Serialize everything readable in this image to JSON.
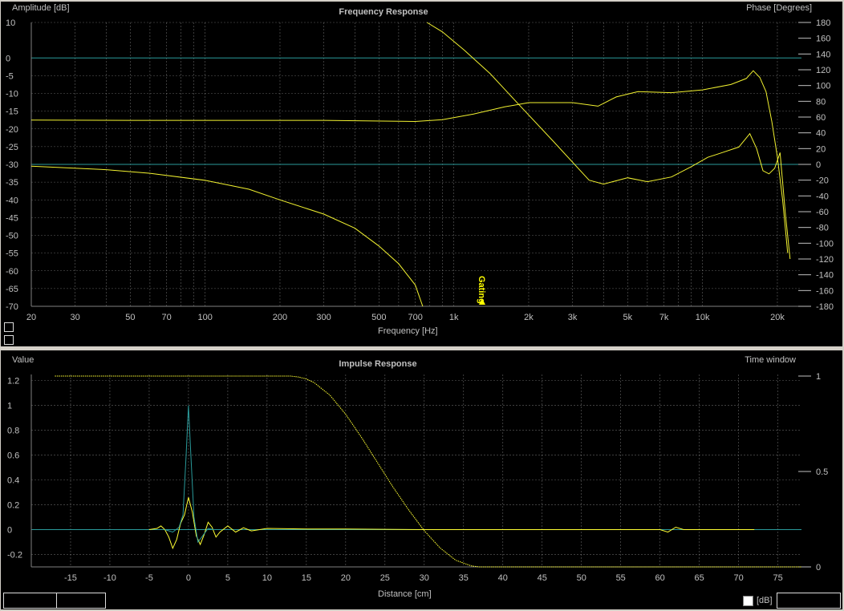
{
  "colors": {
    "background": "#000000",
    "grid": "#b4b4b4",
    "text": "#c0c0c0",
    "yellow": "#ffff33",
    "teal": "#2a9a9a",
    "marker": "#ffff00"
  },
  "frequency_panel": {
    "title": "Frequency Response",
    "left_axis_label": "Amplitude [dB]",
    "right_axis_label": "Phase [Degrees]",
    "x_axis_label": "Frequency [Hz]",
    "marker_label": "Gating"
  },
  "impulse_panel": {
    "title": "Impulse Response",
    "left_axis_label": "Value",
    "right_axis_label": "Time window",
    "x_axis_label": "Distance [cm]",
    "db_label": "[dB]"
  },
  "chart_data": [
    {
      "type": "line",
      "title": "Frequency Response",
      "xlabel": "Frequency [Hz]",
      "ylabel": "Amplitude [dB]",
      "y2label": "Phase [Degrees]",
      "xscale": "log",
      "xlim": [
        20,
        25000
      ],
      "ylim": [
        -70,
        10
      ],
      "y2lim": [
        -180,
        180
      ],
      "grid": true,
      "x_ticks": [
        20,
        30,
        50,
        70,
        100,
        200,
        300,
        500,
        700,
        1000,
        2000,
        3000,
        5000,
        7000,
        10000,
        20000
      ],
      "x_tick_labels": [
        "20",
        "30",
        "50",
        "70",
        "100",
        "200",
        "300",
        "500",
        "700",
        "1k",
        "2k",
        "3k",
        "5k",
        "7k",
        "10k",
        "20k"
      ],
      "y_ticks": [
        10,
        0,
        -5,
        -10,
        -15,
        -20,
        -25,
        -30,
        -35,
        -40,
        -45,
        -50,
        -55,
        -60,
        -65,
        -70
      ],
      "y2_ticks": [
        180,
        160,
        140,
        120,
        100,
        80,
        60,
        40,
        20,
        0,
        -20,
        -40,
        -60,
        -80,
        -100,
        -120,
        -140,
        -160,
        -180
      ],
      "reference_lines_db": [
        0,
        -30
      ],
      "gating_marker_hz": 1300,
      "series": [
        {
          "axis": "left",
          "x": [
            20,
            50,
            100,
            300,
            700,
            900,
            1200,
            1600,
            2000,
            3000,
            3800,
            4500,
            5500,
            7500,
            10000,
            13000,
            15000,
            16000,
            17000,
            18000,
            19000,
            20000,
            21000,
            22000
          ],
          "y": [
            -17.5,
            -17.6,
            -17.6,
            -17.6,
            -17.9,
            -17.4,
            -15.8,
            -13.8,
            -12.6,
            -12.6,
            -13.6,
            -11.0,
            -9.5,
            -9.8,
            -9.0,
            -7.5,
            -5.8,
            -3.6,
            -5.5,
            -9.5,
            -18,
            -28,
            -40,
            -55
          ]
        },
        {
          "axis": "left",
          "x": [
            20,
            40,
            60,
            100,
            150,
            200,
            300,
            400,
            500,
            600,
            700,
            750
          ],
          "y": [
            -30.5,
            -31.5,
            -32.5,
            -34.5,
            -37,
            -40,
            -44,
            -48,
            -53,
            -58,
            -64,
            -70
          ]
        },
        {
          "axis": "right",
          "x": [
            780,
            900,
            1100,
            1400,
            1800,
            2500,
            3500,
            4000,
            5000,
            6000,
            7500,
            9000,
            10500,
            12000,
            14000,
            15500,
            16500,
            17500,
            18500,
            19500,
            20500,
            21500,
            22500
          ],
          "y": [
            180,
            168,
            145,
            115,
            78,
            30,
            -20,
            -25,
            -17,
            -22,
            -16,
            -3,
            9,
            15,
            22,
            39,
            20,
            -8,
            -12,
            -5,
            15,
            -60,
            -120
          ]
        }
      ]
    },
    {
      "type": "line",
      "title": "Impulse Response",
      "xlabel": "Distance [cm]",
      "ylabel": "Value",
      "y2label": "Time window",
      "xlim": [
        -20,
        78
      ],
      "ylim": [
        -0.3,
        1.25
      ],
      "y2lim": [
        0,
        1
      ],
      "grid": true,
      "x_ticks": [
        -15,
        -10,
        -5,
        0,
        5,
        10,
        15,
        20,
        25,
        30,
        35,
        40,
        45,
        50,
        55,
        60,
        65,
        70,
        75
      ],
      "y_ticks": [
        1.2,
        1,
        0.8,
        0.6,
        0.4,
        0.2,
        0,
        -0.2
      ],
      "y2_ticks": [
        1,
        0.5,
        0
      ],
      "series": [
        {
          "axis": "right",
          "x": [
            -17,
            13,
            14,
            15,
            16,
            18,
            20,
            22,
            24,
            26,
            28,
            30,
            32,
            34,
            36,
            37,
            78
          ],
          "y": [
            1,
            1,
            0.995,
            0.985,
            0.965,
            0.9,
            0.8,
            0.68,
            0.55,
            0.42,
            0.3,
            0.19,
            0.1,
            0.035,
            0.005,
            0,
            0
          ]
        },
        {
          "axis": "left",
          "x": [
            -5,
            -4,
            -3.5,
            -3,
            -2.5,
            -2,
            -1.5,
            -1,
            -0.5,
            0,
            0.5,
            1,
            1.5,
            2,
            2.5,
            3,
            3.5,
            4,
            5,
            6,
            7,
            8,
            10,
            15,
            20,
            30,
            60,
            61,
            62,
            63,
            72
          ],
          "y": [
            0,
            0.01,
            0.03,
            0.0,
            -0.06,
            -0.15,
            -0.08,
            0.05,
            0.12,
            0.26,
            0.14,
            -0.05,
            -0.12,
            -0.04,
            0.06,
            0.02,
            -0.06,
            -0.02,
            0.03,
            -0.02,
            0.015,
            -0.01,
            0.01,
            0.005,
            0.005,
            0,
            0,
            -0.02,
            0.02,
            0,
            0
          ]
        },
        {
          "axis": "left",
          "x": [
            -3,
            -2,
            -1.2,
            -0.7,
            -0.3,
            0,
            0.3,
            0.7,
            1.2,
            1.8,
            2.5,
            3.2
          ],
          "y": [
            0,
            -0.02,
            0.02,
            0.12,
            0.6,
            1.0,
            0.6,
            0.1,
            -0.1,
            -0.05,
            0.01,
            0
          ]
        }
      ]
    }
  ]
}
